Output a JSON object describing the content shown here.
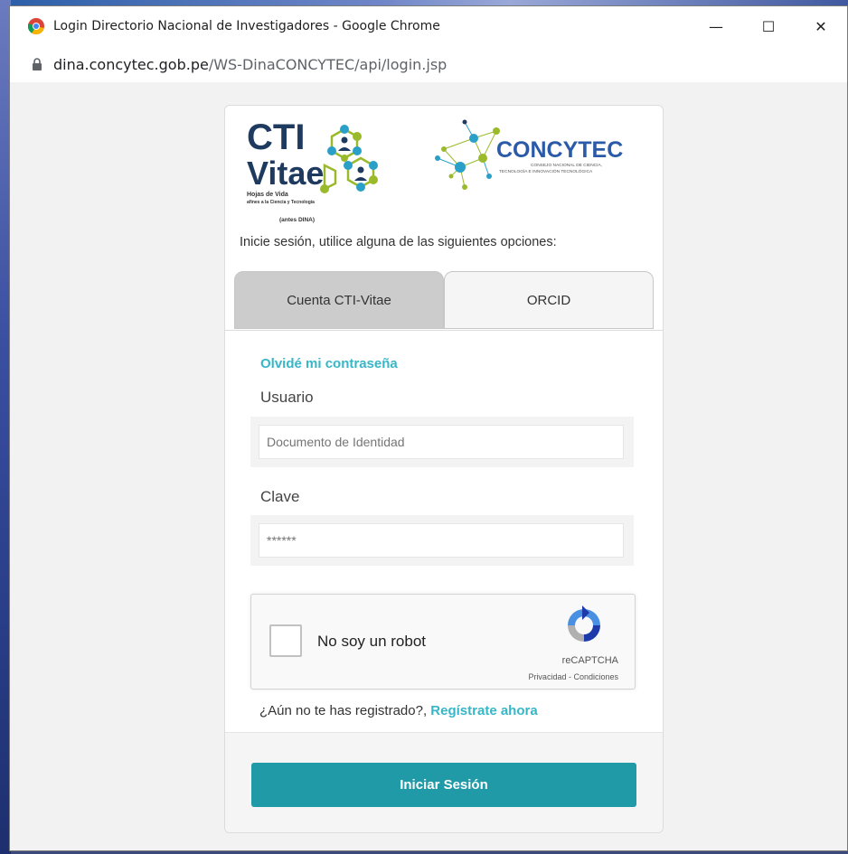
{
  "window": {
    "title": "Login Directorio Nacional de Investigadores - Google Chrome",
    "url_host": "dina.concytec.gob.pe",
    "url_path": "/WS-DinaCONCYTEC/api/login.jsp",
    "controls": {
      "minimize": "—",
      "maximize": "☐",
      "close": "✕"
    }
  },
  "logos": {
    "cti_top": "CTI",
    "cti_vitae": "Vitae",
    "cti_sub1": "Hojas de Vida",
    "cti_sub2": "afines a la Ciencia y Tecnología",
    "cti_sub3": "(antes DINA)",
    "concytec_name": "CONCYTEC",
    "concytec_sub1": "CONSEJO NACIONAL DE CIENCIA,",
    "concytec_sub2": "TECNOLOGÍA E INNOVACIÓN TECNOLÓGICA"
  },
  "login": {
    "intro": "Inicie sesión, utilice alguna de las siguientes opciones:",
    "tabs": [
      {
        "label": "Cuenta CTI-Vitae",
        "active": true
      },
      {
        "label": "ORCID",
        "active": false
      }
    ],
    "forgot_password": "Olvidé mi contraseña",
    "user_label": "Usuario",
    "user_placeholder": "Documento de Identidad",
    "password_label": "Clave",
    "password_placeholder": "******",
    "captcha_label": "No soy un robot",
    "captcha_brand": "reCAPTCHA",
    "captcha_terms": "Privacidad - Condiciones",
    "register_prompt": "¿Aún no te has registrado?,",
    "register_link": "Regístrate ahora",
    "submit_label": "Iniciar Sesión"
  },
  "colors": {
    "accent": "#1f9aa6",
    "link": "#37b6c8",
    "tab_active": "#cccccc",
    "cti_dark": "#1e3a5f",
    "cti_green": "#9aba2c"
  }
}
